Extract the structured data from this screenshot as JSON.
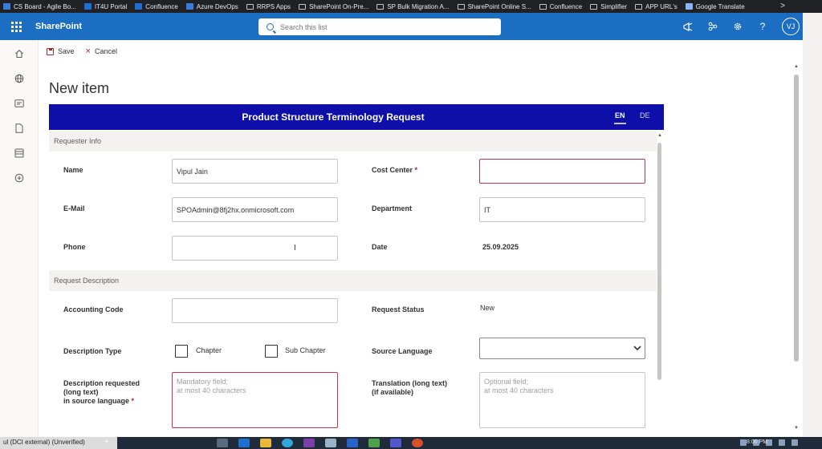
{
  "bookmarks": [
    {
      "label": "CS Board - Agile Bo...",
      "icon": "jira-icon"
    },
    {
      "label": "IT4U Portal",
      "icon": "portal-icon"
    },
    {
      "label": "Confluence",
      "icon": "confluence-icon"
    },
    {
      "label": "Azure DevOps",
      "icon": "devops-icon"
    },
    {
      "label": "RRPS Apps",
      "icon": "folder-icon"
    },
    {
      "label": "SharePoint On-Pre...",
      "icon": "folder-icon"
    },
    {
      "label": "SP Bulk Migration A...",
      "icon": "folder-icon"
    },
    {
      "label": "SharePoint Online S...",
      "icon": "folder-icon"
    },
    {
      "label": "Confluence",
      "icon": "folder-icon"
    },
    {
      "label": "Simplifier",
      "icon": "folder-icon"
    },
    {
      "label": "APP URL's",
      "icon": "folder-icon"
    },
    {
      "label": "Google Translate",
      "icon": "translate-icon"
    }
  ],
  "bookmarks_more": ">",
  "suite": {
    "app_name": "SharePoint",
    "search_placeholder": "Search this list",
    "avatar_initials": "VJ",
    "accent": "#1b6ec2"
  },
  "commands": {
    "save": "Save",
    "cancel": "Cancel"
  },
  "page_title": "New item",
  "form": {
    "banner_title": "Product Structure Terminology Request",
    "banner_color": "#0d0fa8",
    "lang_en": "EN",
    "lang_de": "DE",
    "section_requester": "Requester Info",
    "section_description": "Request Description",
    "name_label": "Name",
    "name_value": "Vipul Jain",
    "cost_center_label": "Cost Center",
    "required_mark": "*",
    "email_label": "E-Mail",
    "email_value": "SPOAdmin@8fj2hx.onmicrosoft.com",
    "department_label": "Department",
    "department_value": "IT",
    "phone_label": "Phone",
    "date_label": "Date",
    "date_value": "25.09.2025",
    "accounting_label": "Accounting Code",
    "status_label": "Request Status",
    "status_value": "New",
    "desc_type_label": "Description Type",
    "chapter_label": "Chapter",
    "sub_chapter_label": "Sub Chapter",
    "source_lang_label": "Source Language",
    "desc_req_label_1": "Description requested",
    "desc_req_label_2": "(long text)",
    "desc_req_label_3": "in source language",
    "desc_req_placeholder": "Mandatory field;\nat most 40 characters",
    "translation_label_1": "Translation (long text)",
    "translation_label_2": "(if available)",
    "translation_placeholder": "Optional field;\nat most 40 characters",
    "error_color": "#c8324f"
  },
  "taskbar": {
    "status_text": "ul (DCI external) (Unverified)",
    "plus": "+",
    "time": "8:06 PM"
  }
}
